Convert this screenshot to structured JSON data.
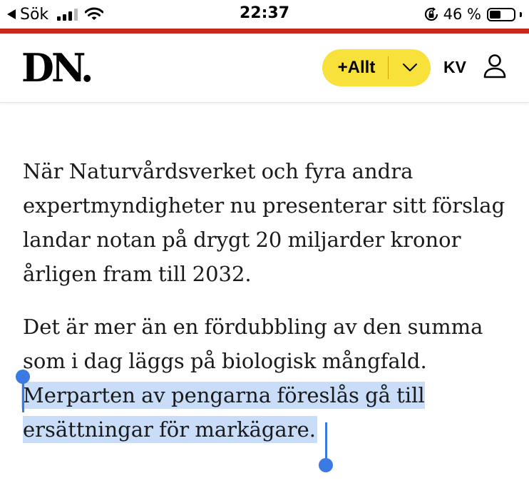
{
  "status_bar": {
    "back_label": "Sök",
    "time": "22:37",
    "battery_percent_label": "46 %",
    "battery_level": 0.46,
    "signal_bars_active": 3,
    "signal_bars_total": 4,
    "icons": [
      "back-arrow-icon",
      "cellular-signal-icon",
      "wifi-icon",
      "orientation-lock-icon",
      "battery-icon"
    ]
  },
  "header": {
    "logo_text": "DN.",
    "plus_button_label": "+Allt",
    "account_initials": "KV",
    "icons": [
      "chevron-down-icon",
      "user-icon"
    ],
    "colors": {
      "brand_stripe": "#c7291f",
      "plus_pill": "#f7e13a",
      "selection_highlight": "#c9ddf8",
      "selection_handle": "#3b7ae3"
    }
  },
  "article": {
    "paragraph_1": "När Naturvårdsverket och fyra andra expertmyndigheter nu presenterar sitt förslag landar notan på drygt 20 miljarder kronor årligen fram till 2032.",
    "paragraph_2_plain": "Det är mer än en fördubbling av den summa som i dag läggs på biologisk mångfald. ",
    "paragraph_2_selected": "Merparten av pengarna föreslås gå till ersättningar för markägare."
  }
}
